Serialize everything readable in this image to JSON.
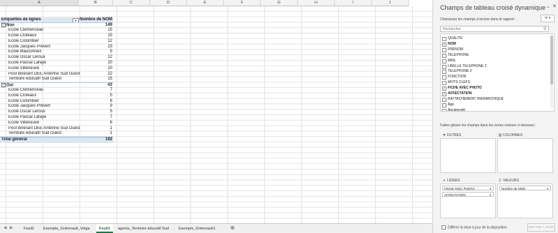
{
  "sheet": {
    "columns": [
      "A",
      "B",
      "C",
      "D",
      "E",
      "F",
      "G",
      "H",
      "I",
      "J"
    ],
    "selected_column": "A",
    "pivot_header": {
      "row_label": "Étiquettes de lignes",
      "value_label": "Nombre de NOM"
    },
    "groups": [
      {
        "label": "Non",
        "value": "149",
        "items": [
          {
            "label": "Ecole Clémenceau",
            "value": "15"
          },
          {
            "label": "Ecole Cloteaux",
            "value": "15"
          },
          {
            "label": "Ecole Colombier",
            "value": "12"
          },
          {
            "label": "Ecole Jacques Prévert",
            "value": "23"
          },
          {
            "label": "Ecole Mauconseil",
            "value": "5"
          },
          {
            "label": "Ecole Oscar Leroux",
            "value": "12"
          },
          {
            "label": "Ecole Pascal Lafaye",
            "value": "20"
          },
          {
            "label": "Ecole Villeneuve",
            "value": "10"
          },
          {
            "label": "Pool itinérant DEE Antenne Sud Ouest",
            "value": "22"
          },
          {
            "label": "Territoire éducatif Sud Ouest",
            "value": "15"
          }
        ]
      },
      {
        "label": "Oui",
        "value": "43",
        "items": [
          {
            "label": "Ecole Clémenceau",
            "value": "7"
          },
          {
            "label": "Ecole Cloteaux",
            "value": "5"
          },
          {
            "label": "Ecole Colombier",
            "value": "6"
          },
          {
            "label": "Ecole Jacques Prévert",
            "value": "9"
          },
          {
            "label": "Ecole Oscar Leroux",
            "value": "5"
          },
          {
            "label": "Ecole Pascal Lafaye",
            "value": "7"
          },
          {
            "label": "Ecole Villeneuve",
            "value": "6"
          },
          {
            "label": "Pool itinérant DEE Antenne Sud Ouest",
            "value": "1"
          },
          {
            "label": "Territoire éducatif Sud Ouest",
            "value": "1"
          }
        ]
      }
    ],
    "total": {
      "label": "Total général",
      "value": "192"
    },
    "tabs": [
      "Feuil2",
      "Exemple_Grimmault_Volga",
      "Feuil1",
      "agents_Territoire éducatif Sud",
      "Exemple_Grimmault1"
    ],
    "active_tab": "Feuil1",
    "add_sheet_icon": "plus-circle-icon"
  },
  "pane": {
    "title": "Champs de tableau croisé dynamique",
    "subtitle": "Choisissez les champs à inclure dans le rapport :",
    "search_placeholder": "Rechercher",
    "gear_label": "⚙ ▾",
    "fields": [
      {
        "label": "QUALITE",
        "checked": false
      },
      {
        "label": "NOM",
        "checked": true
      },
      {
        "label": "PRENOM",
        "checked": false
      },
      {
        "label": "TELEPHONE",
        "checked": false
      },
      {
        "label": "MAIL",
        "checked": false
      },
      {
        "label": "LIBELLE TELEPHONE 2",
        "checked": false
      },
      {
        "label": "TELEPHONE 2",
        "checked": false
      },
      {
        "label": "FONCTION",
        "checked": false
      },
      {
        "label": "MOTS CLEFS",
        "checked": false
      },
      {
        "label": "FICHE AVEC PHOTO",
        "checked": true
      },
      {
        "label": "AFFECTATION",
        "checked": true
      },
      {
        "label": "RATTACHEMENT HIERARCHIQUE",
        "checked": false
      },
      {
        "label": "Âge",
        "checked": false
      },
      {
        "label": "Ancienneté",
        "checked": false
      }
    ],
    "drag_hint": "Faites glisser les champs dans les zones voulues ci-dessous :",
    "areas": {
      "filters": "FILTRES",
      "columns": "COLONNES",
      "rows": "LIGNES",
      "values": "VALEURS"
    },
    "row_items": [
      "FICHE AVEC PHOTO",
      "AFFECTATION"
    ],
    "value_items": [
      "Nombre de NOM"
    ],
    "defer_label": "Différer la mise à jour de la disposition",
    "update_label": "METTRE À JOUR"
  },
  "colors": {
    "accent": "#217346",
    "pivot_fill": "#dce6f1"
  }
}
